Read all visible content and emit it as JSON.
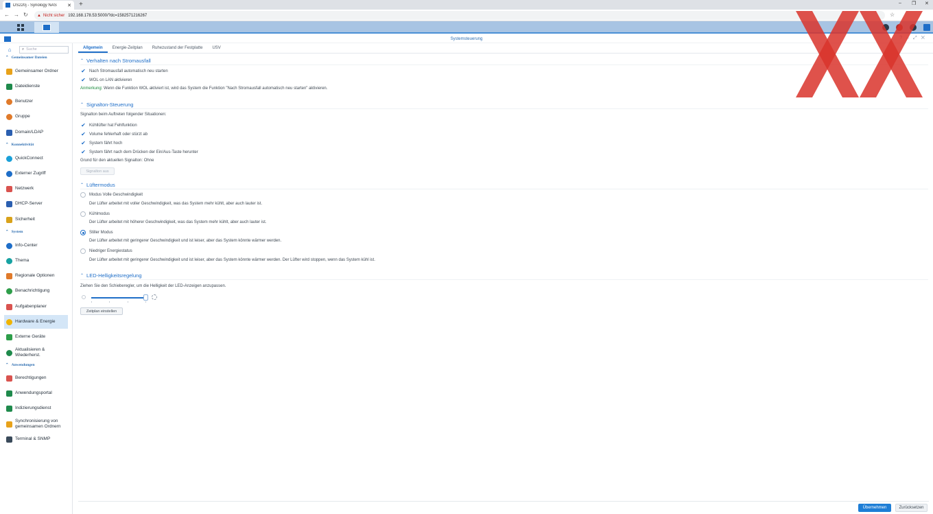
{
  "browser": {
    "tab_title": "DS220j - Synology NAS",
    "tab_close": "✕",
    "new_tab": "+",
    "back": "←",
    "forward": "→",
    "reload": "↻",
    "security_warning": "Nicht sicher",
    "url": "192.168.178.53:5000/?dc=1582571216267"
  },
  "window": {
    "title": "Systemsteuerung"
  },
  "sidebar": {
    "search_placeholder": "Suche",
    "sections": {
      "files": "Gemeinsamer Dateien",
      "connectivity": "Konnektivität",
      "system": "System",
      "applications": "Anwendungen"
    },
    "items": [
      {
        "label": "Gemeinsamer Ordner",
        "icon": "folder-share-icon",
        "color": "#e8a21a"
      },
      {
        "label": "Dateidienste",
        "icon": "file-services-icon",
        "color": "#1f8a4c"
      },
      {
        "label": "Benutzer",
        "icon": "user-icon",
        "color": "#e07a2a"
      },
      {
        "label": "Gruppe",
        "icon": "group-icon",
        "color": "#e07a2a"
      },
      {
        "label": "Domain/LDAP",
        "icon": "domain-icon",
        "color": "#2b5fb0"
      },
      {
        "label": "QuickConnect",
        "icon": "quickconnect-icon",
        "color": "#1aa0d8"
      },
      {
        "label": "Externer Zugriff",
        "icon": "globe-icon",
        "color": "#1e6ec8"
      },
      {
        "label": "Netzwerk",
        "icon": "network-icon",
        "color": "#d9534f"
      },
      {
        "label": "DHCP-Server",
        "icon": "dhcp-icon",
        "color": "#2b5fb0"
      },
      {
        "label": "Sicherheit",
        "icon": "shield-icon",
        "color": "#d9a21a"
      },
      {
        "label": "Info-Center",
        "icon": "info-icon",
        "color": "#1e6ec8"
      },
      {
        "label": "Thema",
        "icon": "theme-icon",
        "color": "#17a2a2"
      },
      {
        "label": "Regionale Optionen",
        "icon": "region-icon",
        "color": "#e07a2a"
      },
      {
        "label": "Benachrichtigung",
        "icon": "notification-icon",
        "color": "#2e9e4a"
      },
      {
        "label": "Aufgabenplaner",
        "icon": "calendar-icon",
        "color": "#d9534f"
      },
      {
        "label": "Hardware & Energie",
        "icon": "bulb-icon",
        "color": "#f0b400"
      },
      {
        "label": "Externe Geräte",
        "icon": "external-device-icon",
        "color": "#2e9e4a"
      },
      {
        "label": "Aktualisieren & Wiederherst.",
        "icon": "update-icon",
        "color": "#1f8a4c"
      },
      {
        "label": "Berechtigungen",
        "icon": "permissions-icon",
        "color": "#d9534f"
      },
      {
        "label": "Anwendungsportal",
        "icon": "portal-icon",
        "color": "#1f8a4c"
      },
      {
        "label": "Indizierungsdienst",
        "icon": "index-icon",
        "color": "#1f8a4c"
      },
      {
        "label": "Synchronisierung von gemeinsamen Ordnern",
        "icon": "sync-icon",
        "color": "#e8a21a"
      },
      {
        "label": "Terminal & SNMP",
        "icon": "terminal-icon",
        "color": "#3a4a5a"
      }
    ]
  },
  "tabs": [
    "Allgemein",
    "Energie-Zeitplan",
    "Ruhezustand der Festplatte",
    "USV"
  ],
  "power_recovery": {
    "title": "Verhalten nach Stromausfall",
    "opt1": "Nach Stromausfall automatisch neu starten",
    "opt2": "WOL on LAN aktivieren",
    "note_label": "Anmerkung:",
    "note_text": " Wenn die Funktion WOL aktiviert ist, wird das System die Funktion \"Nach Stromausfall automatisch neu starten\" aktivieren."
  },
  "beep": {
    "title": "Signalton-Steuerung",
    "intro": "Signalton beim Auftreten folgender Situationen:",
    "opts": [
      "Kühllüfter hat Fehlfunktion",
      "Volume fehlerhaft oder stürzt ab",
      "System fährt hoch",
      "System fährt nach dem Drücken der Ein/Aus-Taste herunter"
    ],
    "reason": "Grund für den aktuellen Signalton: Ohne",
    "button": "Signalton aus"
  },
  "fan": {
    "title": "Lüftermodus",
    "modes": [
      {
        "label": "Modus Volle Geschwindigkeit",
        "desc": "Der Lüfter arbeitet mit voller Geschwindigkeit, was das System mehr kühlt, aber auch lauter ist."
      },
      {
        "label": "Kühlmodus",
        "desc": "Der Lüfter arbeitet mit höherer Geschwindigkeit, was das System mehr kühlt, aber auch lauter ist."
      },
      {
        "label": "Stiller Modus",
        "desc": "Der Lüfter arbeitet mit geringerer Geschwindigkeit und ist leiser, aber das System könnte wärmer werden."
      },
      {
        "label": "Niedriger Energiestatus",
        "desc": "Der Lüfter arbeitet mit geringerer Geschwindigkeit und ist leiser, aber das System könnte wärmer werden. Der Lüfter wird stoppen, wenn das System kühl ist."
      }
    ],
    "selected": 2
  },
  "led": {
    "title": "LED-Helligkeitsregelung",
    "intro": "Ziehen Sie den Schieberegler, um die Helligkeit der LED-Anzeigen anzupassen.",
    "brightness_fraction": 1.0,
    "button": "Zeitplan einstellen"
  },
  "footer": {
    "apply": "Übernehmen",
    "reset": "Zurücksetzen"
  },
  "colors": {
    "accent": "#1e6ec8",
    "watermark": "#d9342b"
  }
}
